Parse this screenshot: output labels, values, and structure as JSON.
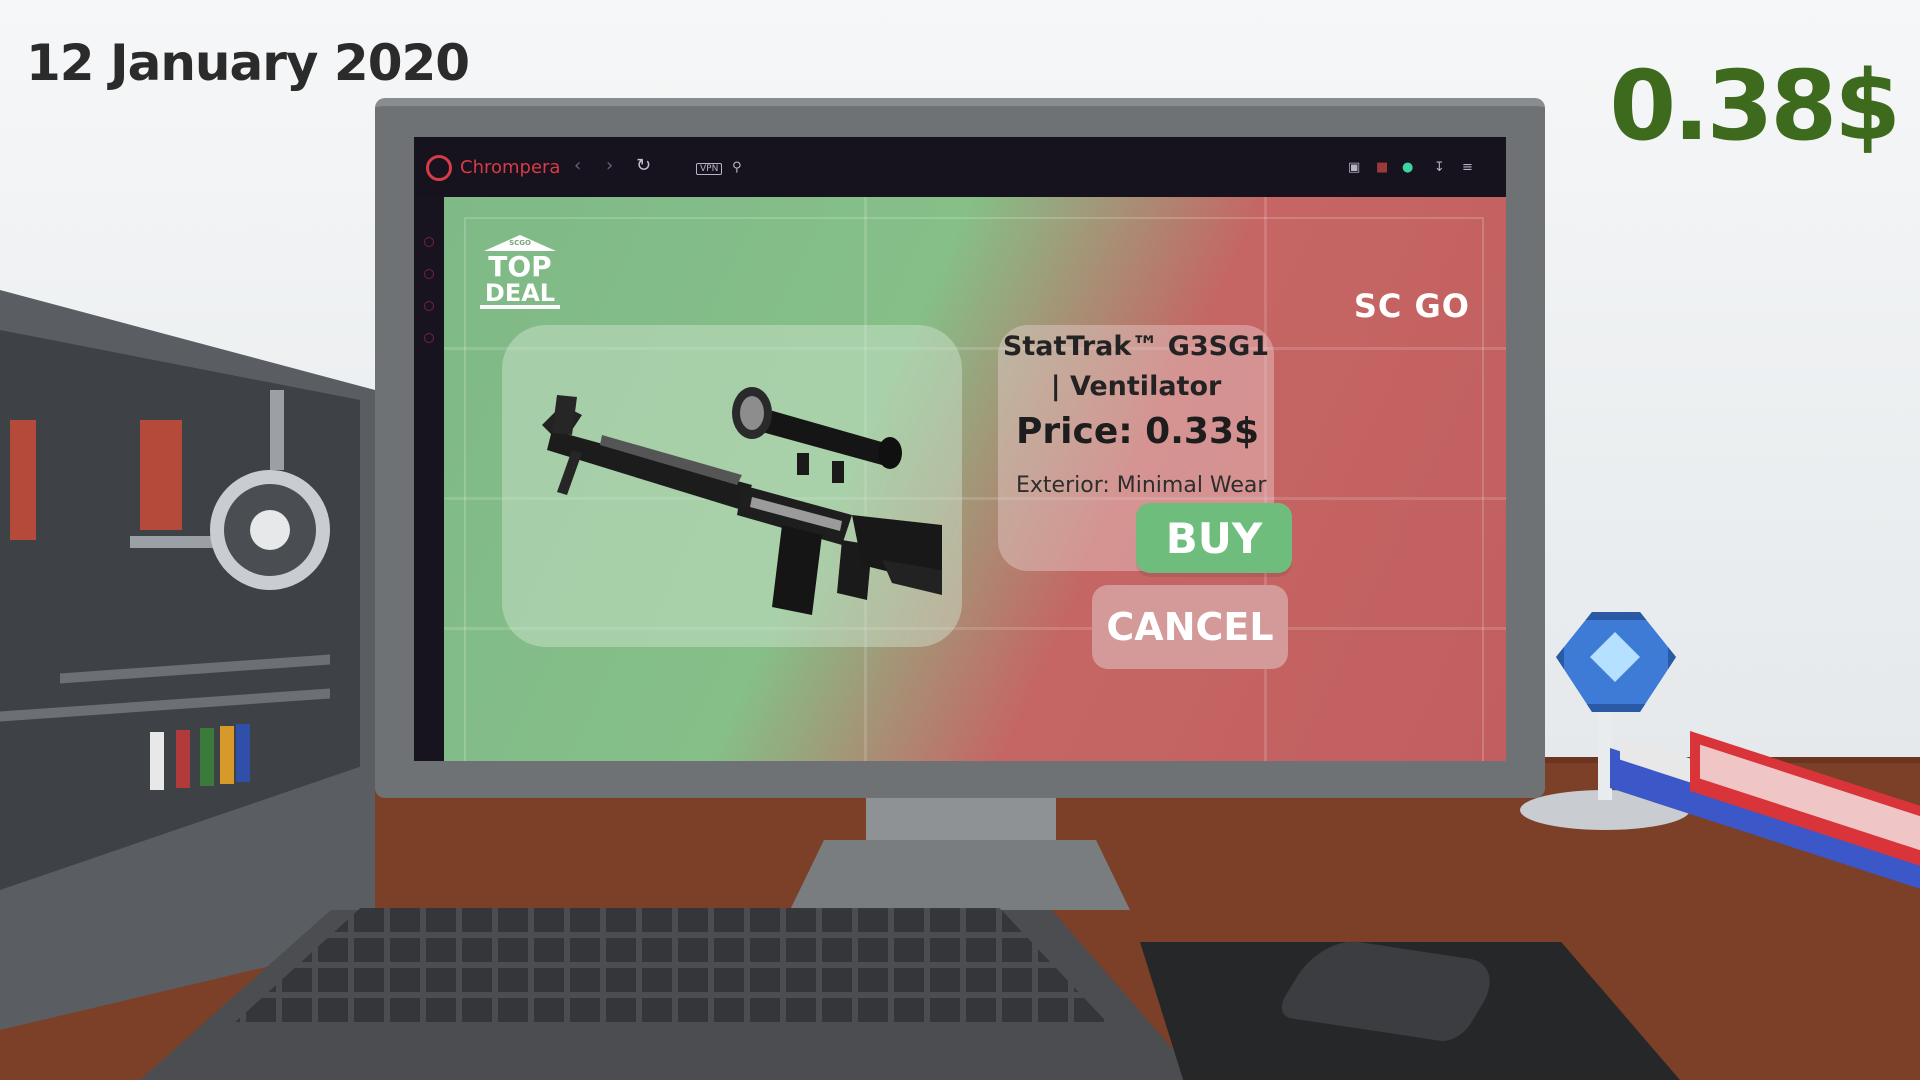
{
  "hud": {
    "date": "12 January 2020",
    "money": "0.38$"
  },
  "browser": {
    "name": "Chrompera",
    "vpn_label": "VPN",
    "icons": [
      "back-icon",
      "forward-icon",
      "reload-icon",
      "search-icon",
      "camera-icon",
      "box-icon",
      "extension-icon",
      "download-icon",
      "settings-icon"
    ]
  },
  "offer": {
    "promo_logo_small": "SCGO",
    "promo_logo_top": "TOP",
    "promo_logo_bottom": "DEAL",
    "game_logo": "SC GO",
    "item_name": "StatTrak™ G3SG1 | Ventilator",
    "price": "Price: 0.33$",
    "exterior": "Exterior: Minimal Wear",
    "buy_label": "BUY",
    "cancel_label": "CANCEL"
  },
  "colors": {
    "money": "#3d6a1c",
    "browser_accent": "#d83a47",
    "buy_button": "#6fbd7c",
    "cancel_button": "#d49a9a"
  }
}
